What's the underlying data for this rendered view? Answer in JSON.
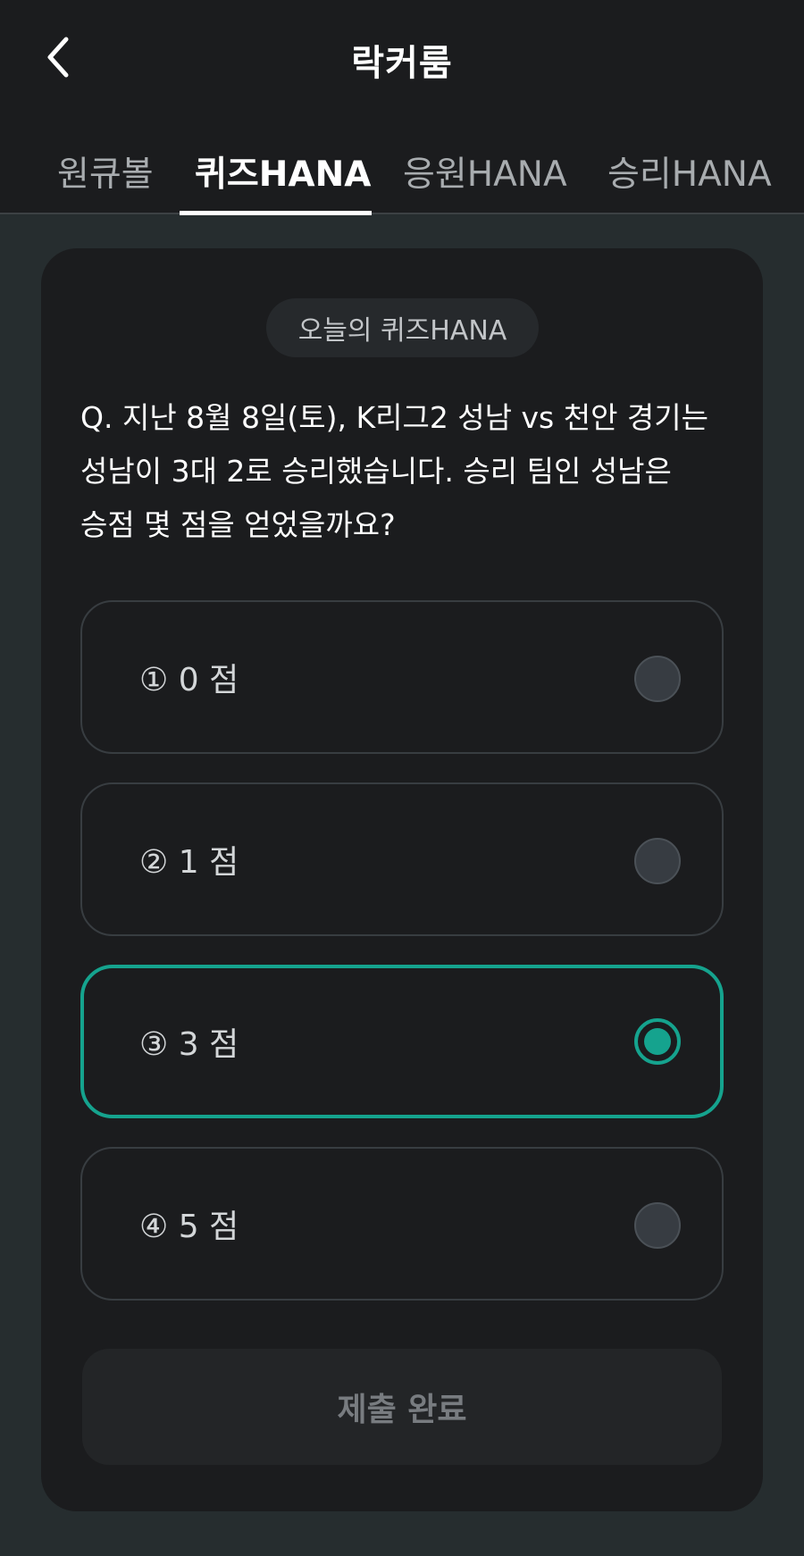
{
  "header": {
    "title": "락커룸",
    "back_icon": "chevron-left-icon"
  },
  "tabs": [
    {
      "label": "원큐볼",
      "active": false
    },
    {
      "label": "퀴즈HANA",
      "active": true
    },
    {
      "label": "응원HANA",
      "active": false
    },
    {
      "label": "승리HANA",
      "active": false
    }
  ],
  "quiz": {
    "badge": "오늘의 퀴즈HANA",
    "question": "Q. 지난 8월 8일(토), K리그2 성남 vs 천안 경기는 성남이 3대 2로 승리했습니다. 승리 팀인 성남은 승점 몇 점을 얻었을까요?",
    "options": [
      {
        "label": "① 0 점",
        "selected": false
      },
      {
        "label": "② 1 점",
        "selected": false
      },
      {
        "label": "③ 3 점",
        "selected": true
      },
      {
        "label": "④ 5 점",
        "selected": false
      }
    ],
    "submit_label": "제출 완료"
  },
  "colors": {
    "accent": "#15a38e",
    "background": "#262d2f",
    "surface": "#1b1c1e"
  }
}
